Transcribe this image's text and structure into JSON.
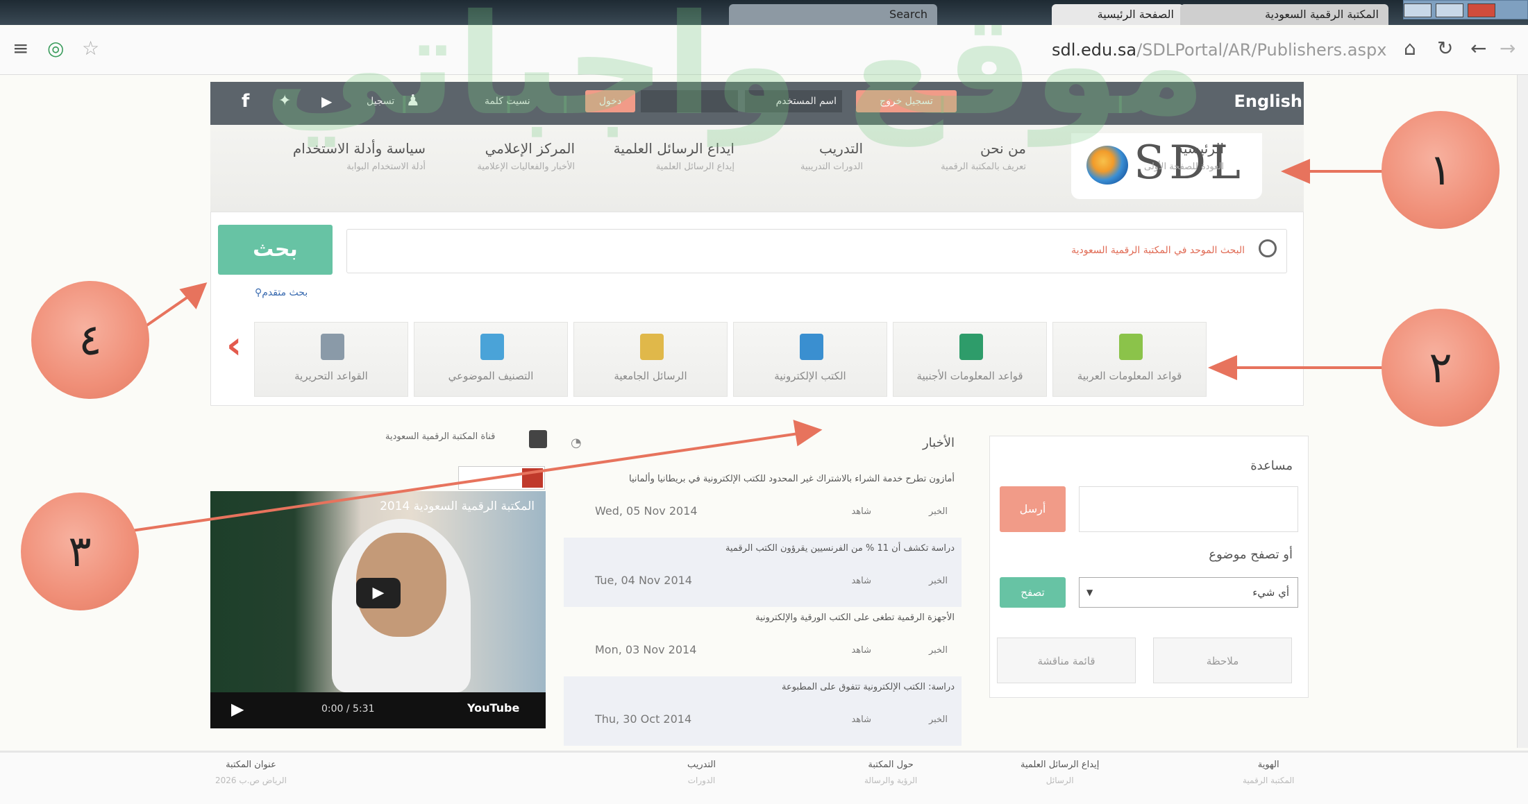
{
  "browser": {
    "tabs": [
      "المكتبة الرقمية السعودية",
      "الصفحة الرئيسية"
    ],
    "search_tab": "Search",
    "url_domain": "sdl.edu.sa",
    "url_path": "/SDLPortal/AR/Publishers.aspx"
  },
  "watermark": "موقع واجباتي",
  "topbar": {
    "english": "English",
    "logout": "تسجيل خروج",
    "username_label": "اسم المستخدم",
    "login": "دخول",
    "search_all": "نسيت كلمة",
    "register": "تسجيل"
  },
  "logo": "SDL",
  "nav": [
    {
      "title": "الرئيسية",
      "sub": "العودة للصفحة الأولى"
    },
    {
      "title": "من نحن",
      "sub": "تعريف بالمكتبة الرقمية"
    },
    {
      "title": "التدريب",
      "sub": "الدورات التدريبية"
    },
    {
      "title": "ايداع الرسائل العلمية",
      "sub": "إيداع الرسائل العلمية"
    },
    {
      "title": "المركز الإعلامي",
      "sub": "الأخبار والفعاليات الإعلامية"
    },
    {
      "title": "سياسة وأدلة الاستخدام",
      "sub": "أدلة الاستخدام البوابة"
    }
  ],
  "search": {
    "button": "بحث",
    "placeholder": "البحث الموحد في المكتبة الرقمية السعودية",
    "advanced": "بحث متقدم"
  },
  "databases": [
    {
      "label": "قواعد المعلومات العربية",
      "color": "#8bc34a"
    },
    {
      "label": "قواعد المعلومات الأجنبية",
      "color": "#2e9c6a"
    },
    {
      "label": "الكتب الإلكترونية",
      "color": "#3a8fd0"
    },
    {
      "label": "الرسائل الجامعية",
      "color": "#e0b84a"
    },
    {
      "label": "التصنيف الموضوعي",
      "color": "#4aa3d8"
    },
    {
      "label": "القواعد التحريرية",
      "color": "#8a9aa8"
    }
  ],
  "callouts": [
    "١",
    "٢",
    "٣",
    "٤"
  ],
  "help": {
    "title": "مساعدة",
    "send": "أرسل",
    "browse": "أو تصفح موضوع",
    "topic": "أي شيء",
    "go": "تصفح",
    "btn_discussion": "قائمة مناقشة",
    "btn_note": "ملاحظة"
  },
  "news": {
    "heading": "الأخبار",
    "items": [
      {
        "title": "أمازون تطرح خدمة الشراء بالاشتراك غير المحدود للكتب الإلكترونية في بريطانيا وألمانيا",
        "date": "Wed, 05 Nov 2014",
        "m1": "الخبر",
        "m2": "شاهد"
      },
      {
        "title": "دراسة تكشف أن 11 % من الفرنسيين يقرؤون الكتب الرقمية",
        "date": "Tue, 04 Nov 2014",
        "m1": "الخبر",
        "m2": "شاهد"
      },
      {
        "title": "الأجهزة الرقمية تطغى على الكتب الورقية والإلكترونية",
        "date": "Mon, 03 Nov 2014",
        "m1": "الخبر",
        "m2": "شاهد"
      },
      {
        "title": "دراسة: الكتب الإلكترونية تتفوق على المطبوعة",
        "date": "Thu, 30 Oct 2014",
        "m1": "الخبر",
        "m2": "شاهد"
      }
    ]
  },
  "channel": "قناة المكتبة الرقمية السعودية",
  "video": {
    "title": "المكتبة الرقمية السعودية 2014",
    "time": "0:00 / 5:31",
    "brand": "YouTube"
  },
  "footer": [
    {
      "title": "الهوية",
      "sub": "المكتبة الرقمية"
    },
    {
      "title": "إيداع الرسائل العلمية",
      "sub": "الرسائل"
    },
    {
      "title": "حول المكتبة",
      "sub": "الرؤية والرسالة"
    },
    {
      "title": "التدريب",
      "sub": "الدورات"
    },
    {
      "title": "عنوان المكتبة",
      "sub": "الرياض ص.ب 2026"
    }
  ]
}
